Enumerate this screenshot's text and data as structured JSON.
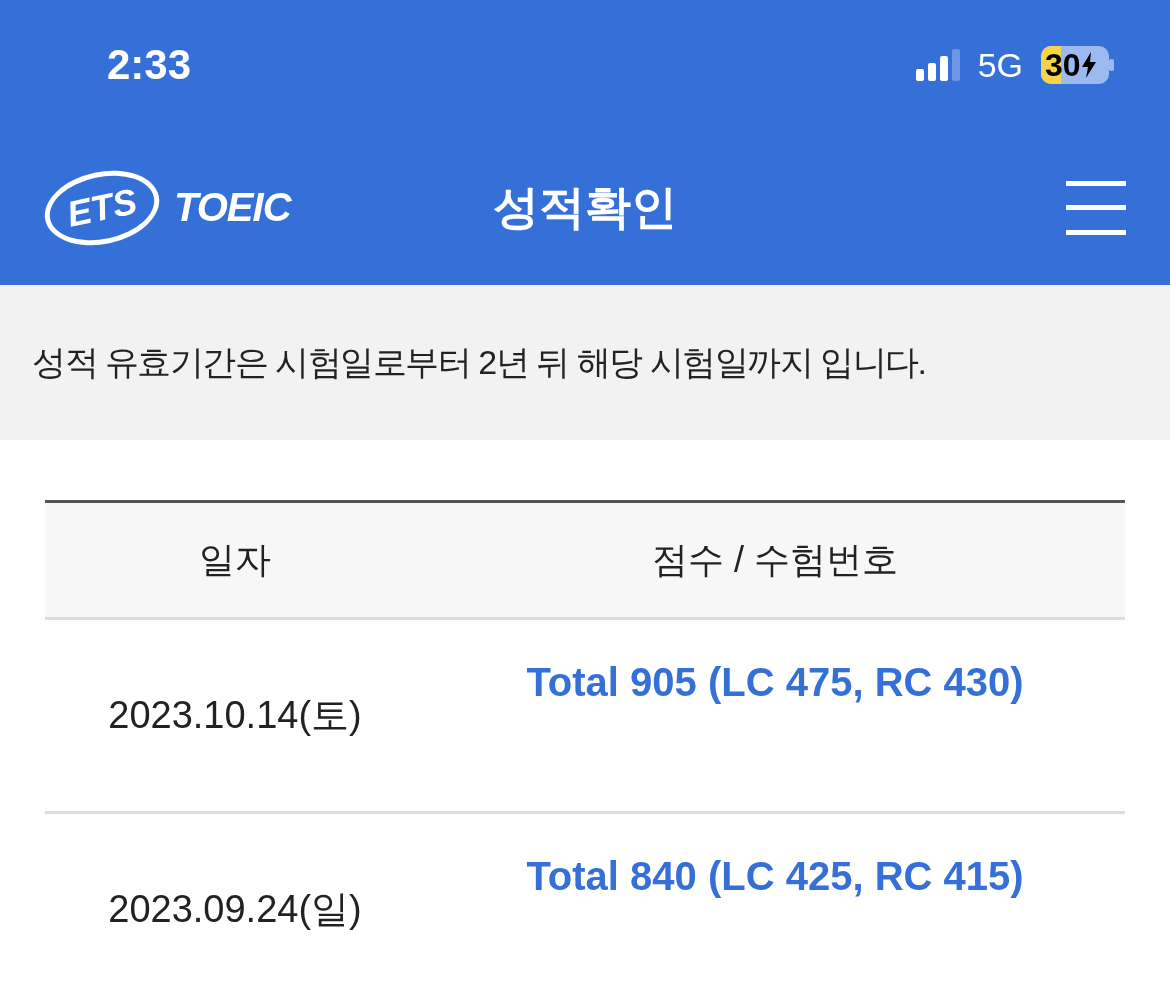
{
  "status_bar": {
    "time": "2:33",
    "network": "5G",
    "battery": "30"
  },
  "header": {
    "logo_mark": "ETS",
    "logo_name": "TOEIC",
    "title": "성적확인"
  },
  "notice": "성적 유효기간은 시험일로부터 2년 뒤 해당 시험일까지 입니다.",
  "table": {
    "columns": [
      "일자",
      "점수 / 수험번호"
    ],
    "rows": [
      {
        "date": "2023.10.14(토)",
        "score": "Total 905 (LC 475, RC 430)"
      },
      {
        "date": "2023.09.24(일)",
        "score": "Total 840 (LC 425, RC 415)"
      }
    ]
  }
}
